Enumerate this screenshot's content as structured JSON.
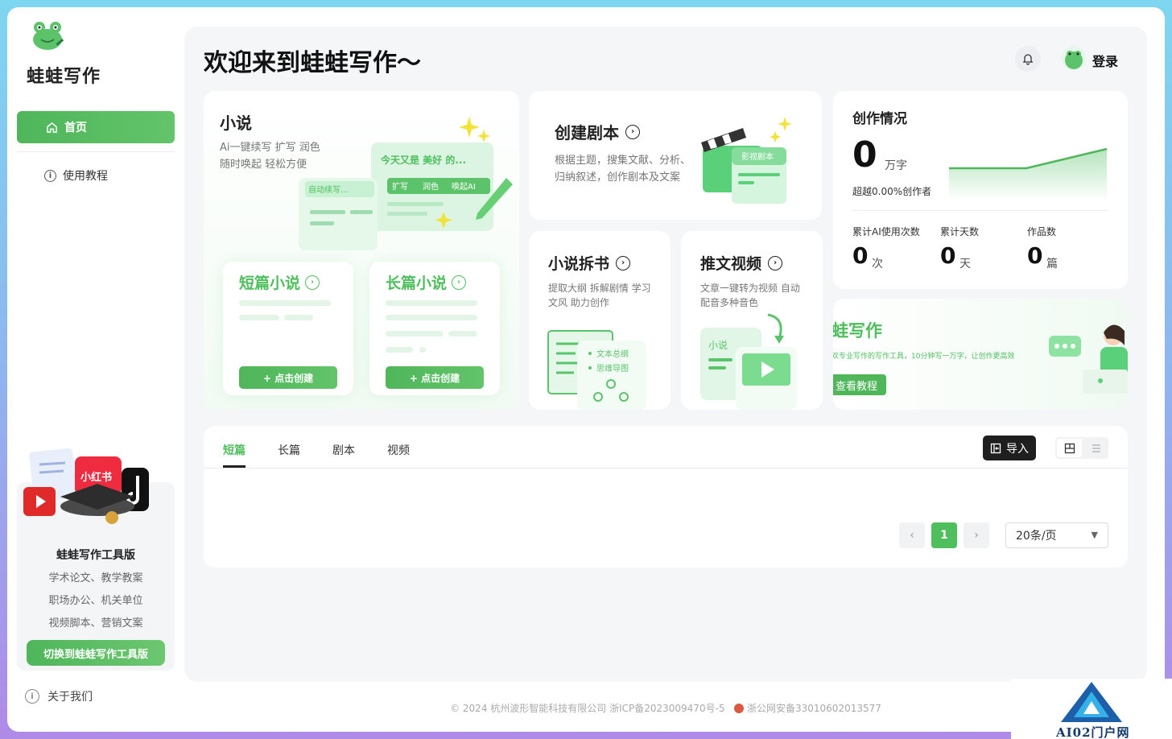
{
  "brand": "蛙蛙写作",
  "nav": {
    "home": "首页",
    "tutorial": "使用教程",
    "about": "关于我们"
  },
  "promo": {
    "badge": "小红书",
    "title": "蛙蛙写作工具版",
    "lines": [
      "学术论文、教学教案",
      "职场办公、机关单位",
      "视频脚本、营销文案"
    ],
    "button": "切换到蛙蛙写作工具版"
  },
  "header": {
    "welcome": "欢迎来到蛙蛙写作～",
    "login": "登录"
  },
  "novel": {
    "title": "小说",
    "desc1": "Ai一键续写 扩写 润色",
    "desc2": "随时唤起 轻松方便",
    "art_bubble": "今天又是 美好 的...",
    "art_tags": [
      "扩写",
      "润色",
      "唤起AI"
    ],
    "art_continue": "自动续写...",
    "short": {
      "title": "短篇小说",
      "button": "+ 点击创建"
    },
    "long": {
      "title": "长篇小说",
      "button": "+ 点击创建"
    }
  },
  "script": {
    "title": "创建剧本",
    "desc1": "根据主题，搜集文献、分析、",
    "desc2": "归纳叙述，创作剧本及文案",
    "art_label": "影视剧本"
  },
  "split": {
    "title": "小说拆书",
    "desc1": "提取大纲 拆解剧情 学习",
    "desc2": "文风 助力创作",
    "art_items": [
      "文本总纲",
      "思维导图"
    ]
  },
  "video": {
    "title": "推文视频",
    "desc1": "文章一键转为视频 自动",
    "desc2": "配音多种音色",
    "art_label": "小说"
  },
  "stats": {
    "title": "创作情况",
    "words_value": "0",
    "words_unit": "万字",
    "percent": "超越0.00%创作者",
    "ai_label": "累计AI使用次数",
    "ai_value": "0",
    "ai_unit": "次",
    "days_label": "累计天数",
    "days_value": "0",
    "days_unit": "天",
    "works_label": "作品数",
    "works_value": "0",
    "works_unit": "篇"
  },
  "banner": {
    "title": "蛙写作",
    "desc": "欢专业写作的写作工具，10分钟写一万字，让创作更高效",
    "button": "查看教程"
  },
  "tabs": [
    "短篇",
    "长篇",
    "剧本",
    "视频"
  ],
  "import_label": "导入",
  "pagination": {
    "current": "1",
    "page_size": "20条/页"
  },
  "footer": {
    "copyright": "© 2024 杭州波形智能科技有限公司 浙ICP备2023009470号-5",
    "police": "浙公网安备33010602013577"
  },
  "watermark": "AI02门户网",
  "colors": {
    "accent": "#4fbf5e",
    "dark_button": "#1f1f1f"
  }
}
